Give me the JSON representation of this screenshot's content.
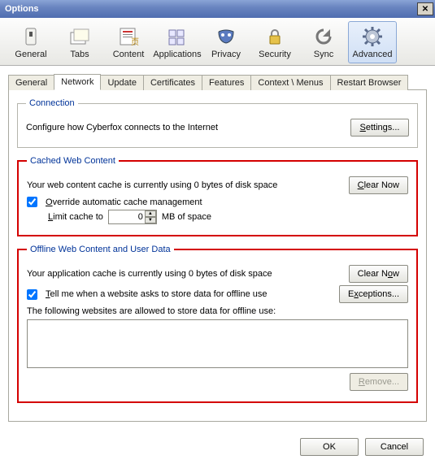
{
  "window": {
    "title": "Options",
    "close_glyph": "✕"
  },
  "toolbar": {
    "items": [
      {
        "label": "General"
      },
      {
        "label": "Tabs"
      },
      {
        "label": "Content"
      },
      {
        "label": "Applications"
      },
      {
        "label": "Privacy"
      },
      {
        "label": "Security"
      },
      {
        "label": "Sync"
      },
      {
        "label": "Advanced",
        "selected": true
      }
    ]
  },
  "subtabs": [
    "General",
    "Network",
    "Update",
    "Certificates",
    "Features",
    "Context \\ Menus",
    "Restart Browser"
  ],
  "subtab_active": "Network",
  "connection": {
    "legend": "Connection",
    "desc": "Configure how Cyberfox connects to the Internet",
    "settings_btn": "Settings..."
  },
  "cache": {
    "legend": "Cached Web Content",
    "usage": "Your web content cache is currently using 0 bytes of disk space",
    "clear_btn": "Clear Now",
    "override_label": "Override automatic cache management",
    "override_checked": true,
    "limit_prefix": "Limit cache to",
    "limit_value": "0",
    "limit_suffix": "MB of space"
  },
  "offline": {
    "legend": "Offline Web Content and User Data",
    "usage": "Your application cache is currently using 0 bytes of disk space",
    "clear_btn": "Clear Now",
    "tell_label": "Tell me when a website asks to store data for offline use",
    "tell_checked": true,
    "exceptions_btn": "Exceptions...",
    "allowed_desc": "The following websites are allowed to store data for offline use:",
    "remove_btn": "Remove..."
  },
  "footer": {
    "ok": "OK",
    "cancel": "Cancel"
  }
}
